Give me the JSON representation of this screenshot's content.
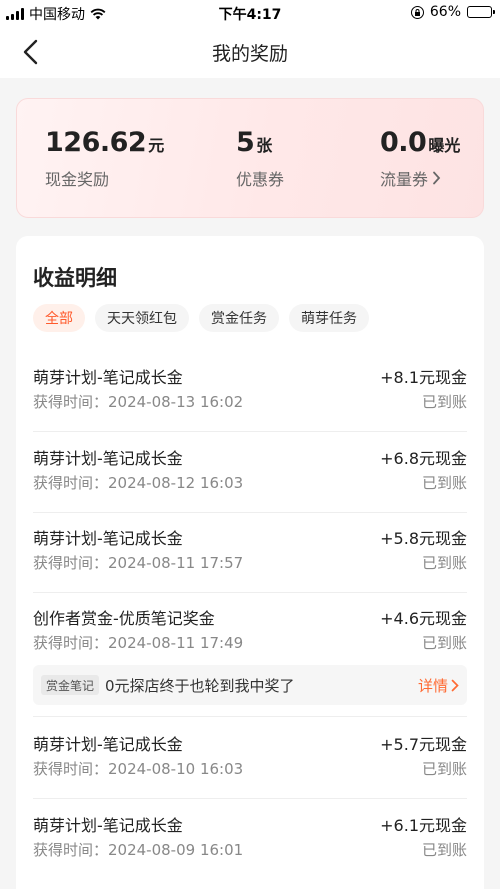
{
  "status_bar": {
    "carrier": "中国移动",
    "time": "下午4:17",
    "battery_text": "66%",
    "battery_level": 0.66
  },
  "nav": {
    "title": "我的奖励"
  },
  "summary": {
    "cash": {
      "value": "126.62",
      "unit": "元",
      "label": "现金奖励"
    },
    "coupons": {
      "value": "5",
      "unit": "张",
      "label": "优惠券"
    },
    "traffic": {
      "value": "0.0",
      "unit": "曝光",
      "label": "流量券"
    }
  },
  "earnings": {
    "title": "收益明细",
    "filters": [
      "全部",
      "天天领红包",
      "赏金任务",
      "萌芽任务"
    ],
    "records": [
      {
        "title": "萌芽计划-笔记成长金",
        "amount": "+8.1元现金",
        "time": "获得时间：2024-08-13 16:02",
        "status": "已到账"
      },
      {
        "title": "萌芽计划-笔记成长金",
        "amount": "+6.8元现金",
        "time": "获得时间：2024-08-12 16:03",
        "status": "已到账"
      },
      {
        "title": "萌芽计划-笔记成长金",
        "amount": "+5.8元现金",
        "time": "获得时间：2024-08-11 17:57",
        "status": "已到账"
      },
      {
        "title": "创作者赏金-优质笔记奖金",
        "amount": "+4.6元现金",
        "time": "获得时间：2024-08-11 17:49",
        "status": "已到账",
        "tag": {
          "label": "赏金笔记",
          "text": "0元探店终于也轮到我中奖了",
          "link": "详情"
        }
      },
      {
        "title": "萌芽计划-笔记成长金",
        "amount": "+5.7元现金",
        "time": "获得时间：2024-08-10 16:03",
        "status": "已到账"
      },
      {
        "title": "萌芽计划-笔记成长金",
        "amount": "+6.1元现金",
        "time": "获得时间：2024-08-09 16:01",
        "status": "已到账"
      }
    ]
  },
  "colors": {
    "accent": "#ff5a2c",
    "card_bg": "#ffe8e8"
  }
}
